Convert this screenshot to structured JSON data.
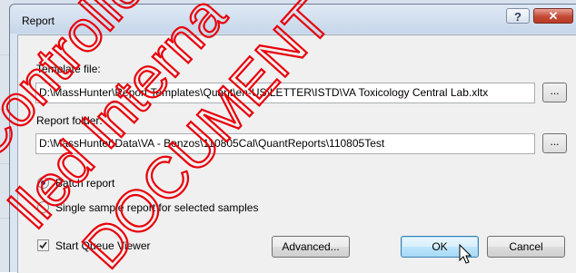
{
  "dialog": {
    "title": "Report",
    "help_glyph": "?",
    "close_glyph": "✕"
  },
  "template_file": {
    "label": "Template file:",
    "value": "D:\\MassHunter\\Report Templates\\Quant\\en-US\\LETTER\\ISTD\\VA Toxicology Central Lab.xltx",
    "browse_label": "..."
  },
  "report_folder": {
    "label": "Report folder:",
    "value": "D:\\MassHunter\\Data\\VA - Benzos\\110805Cal\\QuantReports\\110805Test",
    "browse_label": "..."
  },
  "report_mode": {
    "options": [
      {
        "label": "Batch report",
        "selected": true
      },
      {
        "label": "Single sample report for selected samples",
        "selected": false
      }
    ]
  },
  "start_queue_viewer": {
    "label": "Start Queue Viewer",
    "checked": true
  },
  "buttons": {
    "advanced": "Advanced...",
    "ok": "OK",
    "cancel": "Cancel"
  },
  "watermark": {
    "lines": [
      "Controlled Pe",
      "lled Interna",
      "DOCUMENT"
    ],
    "color": "#e8000a"
  },
  "colors": {
    "titlebar": "#c6d6e9",
    "client": "#f0f0f0",
    "default_button": "#bee6fd",
    "close_button": "#c44a36"
  }
}
